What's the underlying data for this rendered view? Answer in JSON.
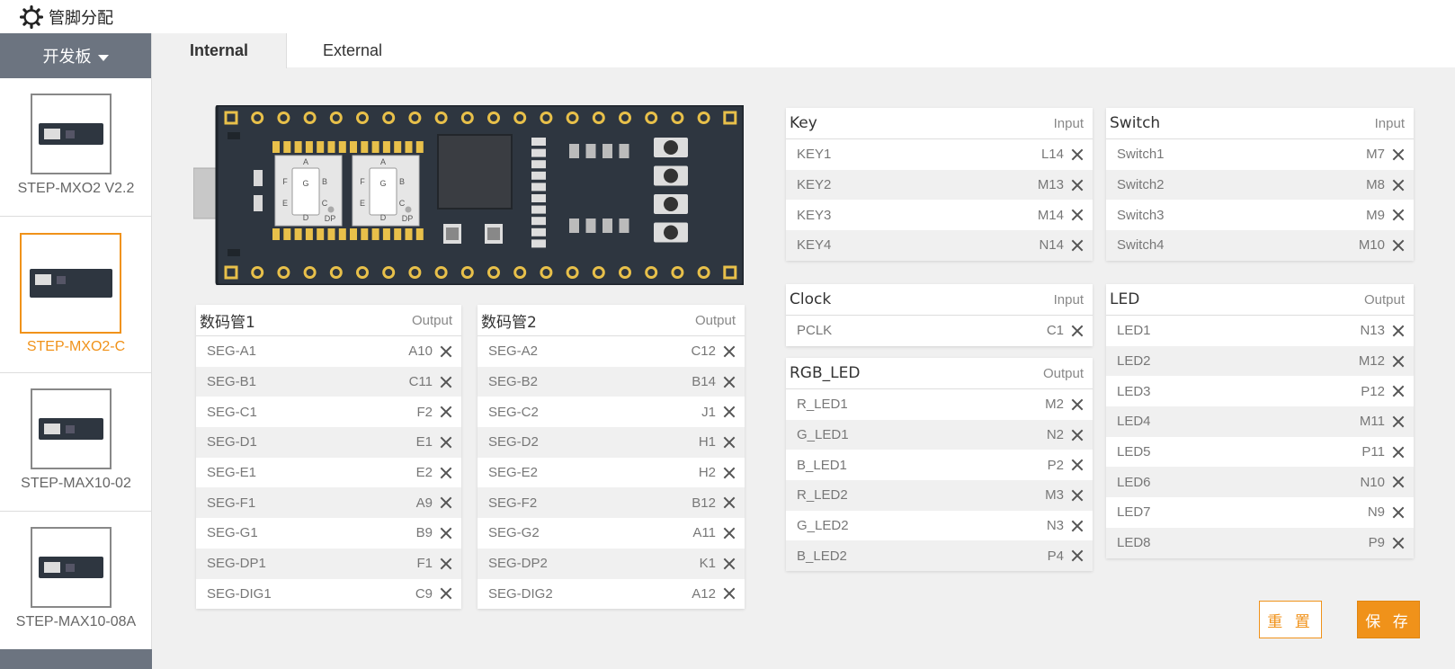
{
  "app": {
    "title": "管脚分配"
  },
  "sidebar": {
    "header": "开发板",
    "boards": [
      {
        "label": "STEP-MXO2 V2.2",
        "active": false
      },
      {
        "label": "STEP-MXO2-C",
        "active": true
      },
      {
        "label": "STEP-MAX10-02",
        "active": false
      },
      {
        "label": "STEP-MAX10-08A",
        "active": false
      }
    ]
  },
  "tabs": [
    {
      "label": "Internal",
      "active": true
    },
    {
      "label": "External",
      "active": false
    }
  ],
  "board_labels": {
    "segments": [
      "A",
      "B",
      "C",
      "D",
      "E",
      "F",
      "G",
      "DP"
    ]
  },
  "panels": {
    "seg1": {
      "title": "数码管1",
      "direction": "Output",
      "rows": [
        {
          "signal": "SEG-A1",
          "pin": "A10"
        },
        {
          "signal": "SEG-B1",
          "pin": "C11"
        },
        {
          "signal": "SEG-C1",
          "pin": "F2"
        },
        {
          "signal": "SEG-D1",
          "pin": "E1"
        },
        {
          "signal": "SEG-E1",
          "pin": "E2"
        },
        {
          "signal": "SEG-F1",
          "pin": "A9"
        },
        {
          "signal": "SEG-G1",
          "pin": "B9"
        },
        {
          "signal": "SEG-DP1",
          "pin": "F1"
        },
        {
          "signal": "SEG-DIG1",
          "pin": "C9"
        }
      ]
    },
    "seg2": {
      "title": "数码管2",
      "direction": "Output",
      "rows": [
        {
          "signal": "SEG-A2",
          "pin": "C12"
        },
        {
          "signal": "SEG-B2",
          "pin": "B14"
        },
        {
          "signal": "SEG-C2",
          "pin": "J1"
        },
        {
          "signal": "SEG-D2",
          "pin": "H1"
        },
        {
          "signal": "SEG-E2",
          "pin": "H2"
        },
        {
          "signal": "SEG-F2",
          "pin": "B12"
        },
        {
          "signal": "SEG-G2",
          "pin": "A11"
        },
        {
          "signal": "SEG-DP2",
          "pin": "K1"
        },
        {
          "signal": "SEG-DIG2",
          "pin": "A12"
        }
      ]
    },
    "key": {
      "title": "Key",
      "direction": "Input",
      "rows": [
        {
          "signal": "KEY1",
          "pin": "L14"
        },
        {
          "signal": "KEY2",
          "pin": "M13"
        },
        {
          "signal": "KEY3",
          "pin": "M14"
        },
        {
          "signal": "KEY4",
          "pin": "N14"
        }
      ]
    },
    "switch": {
      "title": "Switch",
      "direction": "Input",
      "rows": [
        {
          "signal": "Switch1",
          "pin": "M7"
        },
        {
          "signal": "Switch2",
          "pin": "M8"
        },
        {
          "signal": "Switch3",
          "pin": "M9"
        },
        {
          "signal": "Switch4",
          "pin": "M10"
        }
      ]
    },
    "clock": {
      "title": "Clock",
      "direction": "Input",
      "rows": [
        {
          "signal": "PCLK",
          "pin": "C1"
        }
      ]
    },
    "rgb": {
      "title": "RGB_LED",
      "direction": "Output",
      "rows": [
        {
          "signal": "R_LED1",
          "pin": "M2"
        },
        {
          "signal": "G_LED1",
          "pin": "N2"
        },
        {
          "signal": "B_LED1",
          "pin": "P2"
        },
        {
          "signal": "R_LED2",
          "pin": "M3"
        },
        {
          "signal": "G_LED2",
          "pin": "N3"
        },
        {
          "signal": "B_LED2",
          "pin": "P4"
        }
      ]
    },
    "led": {
      "title": "LED",
      "direction": "Output",
      "rows": [
        {
          "signal": "LED1",
          "pin": "N13"
        },
        {
          "signal": "LED2",
          "pin": "M12"
        },
        {
          "signal": "LED3",
          "pin": "P12"
        },
        {
          "signal": "LED4",
          "pin": "M11"
        },
        {
          "signal": "LED5",
          "pin": "P11"
        },
        {
          "signal": "LED6",
          "pin": "N10"
        },
        {
          "signal": "LED7",
          "pin": "N9"
        },
        {
          "signal": "LED8",
          "pin": "P9"
        }
      ]
    }
  },
  "buttons": {
    "reset": "重 置",
    "save": "保 存"
  },
  "colors": {
    "accent": "#f0921a",
    "sidebar_header": "#6c7480",
    "board_pcb": "#2e3640",
    "pad_gold": "#e8c04a"
  }
}
